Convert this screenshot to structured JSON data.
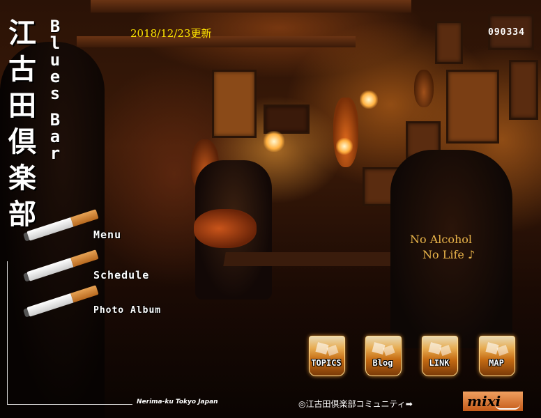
{
  "site": {
    "title_chars": [
      "江",
      "古",
      "田",
      "倶",
      "楽",
      "部"
    ],
    "subtitle_chars": [
      "B",
      "l",
      "u",
      "e",
      "s",
      "",
      "B",
      "a",
      "r"
    ],
    "update_date": "2018/12/23更新",
    "counter": "090334"
  },
  "nav": {
    "menu_label": "Menu",
    "schedule_label": "Schedule",
    "photo_album_label": "Photo Album"
  },
  "photo_buttons": [
    {
      "label": "TOPICS",
      "icon": "whisky-glass-icon"
    },
    {
      "label": "Blog",
      "icon": "whisky-glass-icon"
    },
    {
      "label": "LINK",
      "icon": "whisky-glass-icon"
    },
    {
      "label": "MAP",
      "icon": "whisky-glass-icon"
    }
  ],
  "photo": {
    "shirt_line1": "No Alcohol",
    "shirt_line2": "No Life ♪"
  },
  "footer": {
    "location": "Nerima-ku Tokyo Japan",
    "community": "◎江古田倶楽部コミュニティ➡",
    "mixi_label": "mixi",
    "mixi_sub": "mixi"
  },
  "colors": {
    "update_text": "#ffe400",
    "background": "#2a1206",
    "mixi_bg": "#e07a30"
  }
}
